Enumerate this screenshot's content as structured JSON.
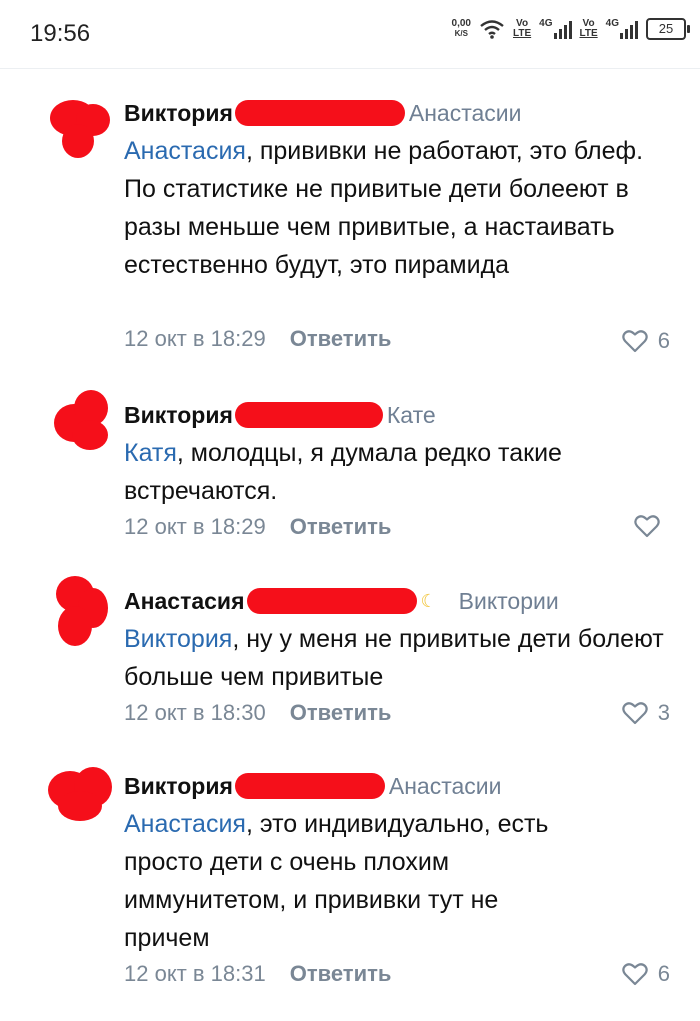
{
  "status_bar": {
    "time": "19:56",
    "speed_value": "0,00",
    "speed_unit": "K/S",
    "wifi_icon": "wifi-icon",
    "sim1_top": "Vo",
    "sim1_bottom": "LTE",
    "sim1_type": "4G",
    "sim2_top": "Vo",
    "sim2_bottom": "LTE",
    "sim2_type": "4G",
    "battery": "25"
  },
  "comments": [
    {
      "author": "Виктория",
      "reply_to": "Анастасии",
      "mention": "Анастасия",
      "text": ", прививки не работают, это блеф. По статистике не привитые дети болееют в разы меньше чем привитые, а настаивать естественно будут, это пирамида",
      "date": "12 окт в 18:29",
      "reply_label": "Ответить",
      "likes": "6"
    },
    {
      "author": "Виктория",
      "reply_to": "Кате",
      "mention": "Катя",
      "text": ", молодцы, я думала редко такие встречаются.",
      "date": "12 окт в 18:29",
      "reply_label": "Ответить",
      "likes": ""
    },
    {
      "author": "Анастасия",
      "reply_to": "Виктории",
      "mention": "Виктория",
      "text": ", ну у меня не привитые дети болеют больше  чем привитые",
      "date": "12 окт в 18:30",
      "reply_label": "Ответить",
      "likes": "3"
    },
    {
      "author": "Виктория",
      "reply_to": "Анастасии",
      "mention": "Анастасия",
      "text": ", это индивидуально, есть просто дети с очень плохим иммунитетом, и прививки тут не причем",
      "date": "12 окт в 18:31",
      "reply_label": "Ответить",
      "likes": "6"
    }
  ],
  "colors": {
    "mention": "#2a6ab0",
    "meta": "#7a8795",
    "redaction": "#f50f1a"
  }
}
